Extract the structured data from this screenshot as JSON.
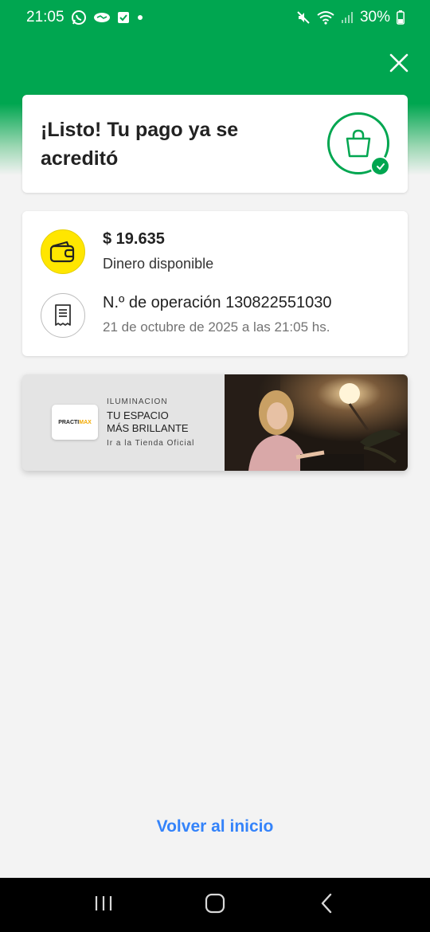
{
  "status_bar": {
    "time": "21:05",
    "battery": "30%",
    "icons": [
      "whatsapp-icon",
      "mercado-libre-icon",
      "check-app-icon",
      "dot-icon",
      "mute-icon",
      "wifi-icon",
      "signal-icon",
      "battery-icon"
    ]
  },
  "header": {
    "close_icon": "close-icon",
    "accent_color": "#00a650"
  },
  "success_card": {
    "title": "¡Listo! Tu pago ya se acreditó",
    "icon": "shopping-bag-icon",
    "badge_icon": "check-icon"
  },
  "details": {
    "amount": "$ 19.635",
    "amount_label": "Dinero disponible",
    "operation": "N.º de operación 130822551030",
    "date": "21 de octubre de 2025 a las 21:05 hs.",
    "wallet_icon": "wallet-icon",
    "receipt_icon": "receipt-icon"
  },
  "banner": {
    "logo_text_a": "PRACTI",
    "logo_text_b": "MAX",
    "category": "ILUMINACION",
    "title_line1": "TU ESPACIO",
    "title_line2": "MÁS BRILLANTE",
    "link": "Ir a la Tienda Oficial"
  },
  "footer": {
    "home_link": "Volver al inicio",
    "link_color": "#3483fa"
  },
  "nav_bar": {
    "icons": [
      "recent-apps-icon",
      "home-icon",
      "back-icon"
    ]
  }
}
